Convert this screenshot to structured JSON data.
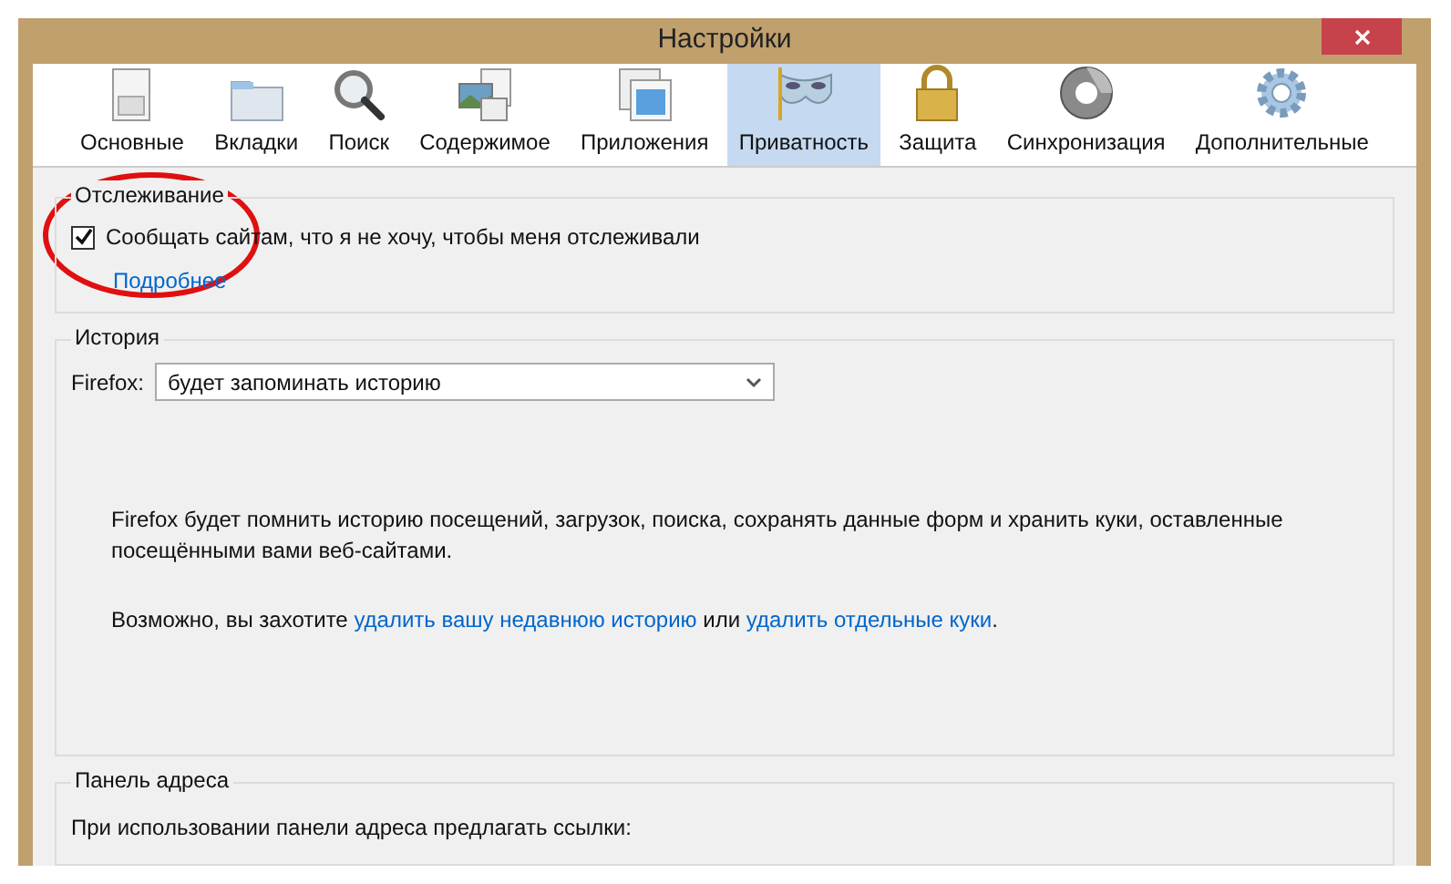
{
  "window": {
    "title": "Настройки"
  },
  "tabs": [
    {
      "label": "Основные",
      "kind": "switch",
      "selected": false
    },
    {
      "label": "Вкладки",
      "kind": "folder",
      "selected": false
    },
    {
      "label": "Поиск",
      "kind": "magnifier",
      "selected": false
    },
    {
      "label": "Содержимое",
      "kind": "content",
      "selected": false
    },
    {
      "label": "Приложения",
      "kind": "apps",
      "selected": false
    },
    {
      "label": "Приватность",
      "kind": "mask",
      "selected": true
    },
    {
      "label": "Защита",
      "kind": "lock",
      "selected": false
    },
    {
      "label": "Синхронизация",
      "kind": "sync",
      "selected": false
    },
    {
      "label": "Дополнительные",
      "kind": "gear",
      "selected": false
    }
  ],
  "tracking": {
    "title": "Отслеживание",
    "checkbox": {
      "label": "Сообщать сайтам, что я не хочу, чтобы меня отслеживали",
      "checked": true
    },
    "link": "Подробнее"
  },
  "history": {
    "title": "История",
    "select_label": "Firefox:",
    "select_value": "будет запоминать историю",
    "description": "Firefox будет помнить историю посещений, загрузок, поиска, сохранять данные форм и хранить куки, оставленные посещёнными вами веб-сайтами.",
    "hint": [
      {
        "kind": "text",
        "text": "Возможно, вы захотите "
      },
      {
        "kind": "link",
        "text": "удалить вашу недавнюю историю"
      },
      {
        "kind": "text",
        "text": " или "
      },
      {
        "kind": "link",
        "text": "удалить отдельные куки"
      },
      {
        "kind": "text",
        "text": "."
      }
    ]
  },
  "address_bar": {
    "title": "Панель адреса",
    "label": "При использовании панели адреса предлагать ссылки:"
  }
}
